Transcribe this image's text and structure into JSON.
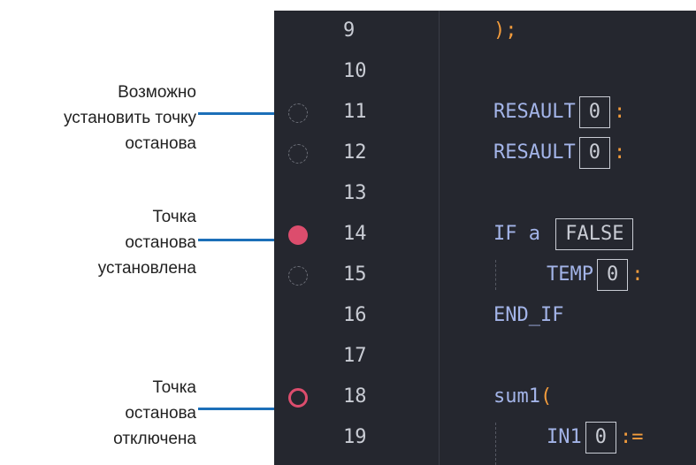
{
  "legend": [
    {
      "lines": [
        "Возможно",
        "установить точку",
        "останова"
      ]
    },
    {
      "lines": [
        "Точка",
        "останова",
        "установлена"
      ]
    },
    {
      "lines": [
        "Точка",
        "останова",
        "отключена"
      ]
    }
  ],
  "editor": {
    "lines": [
      {
        "n": "9",
        "bp": "none"
      },
      {
        "n": "10",
        "bp": "none"
      },
      {
        "n": "11",
        "bp": "possible"
      },
      {
        "n": "12",
        "bp": "possible"
      },
      {
        "n": "13",
        "bp": "none"
      },
      {
        "n": "14",
        "bp": "set"
      },
      {
        "n": "15",
        "bp": "possible"
      },
      {
        "n": "16",
        "bp": "none"
      },
      {
        "n": "17",
        "bp": "none"
      },
      {
        "n": "18",
        "bp": "disabled"
      },
      {
        "n": "19",
        "bp": "none"
      }
    ],
    "code": {
      "l9": ");",
      "l11_kw": "RESAULT",
      "l11_val": "0",
      "l11_op": ":",
      "l12_kw": "RESAULT",
      "l12_val": "0",
      "l12_op": ":",
      "l14_kw": "IF a",
      "l14_val": "FALSE",
      "l15_kw": "TEMP",
      "l15_val": "0",
      "l15_op": ":",
      "l16_kw": "END_IF",
      "l18_kw": "sum1",
      "l18_paren": "(",
      "l19_kw": "IN1",
      "l19_val": "0",
      "l19_op": ":="
    }
  },
  "colors": {
    "breakpoint": "#dc4d6d",
    "callout": "#1c6fb8",
    "editor_bg": "#25272f"
  }
}
